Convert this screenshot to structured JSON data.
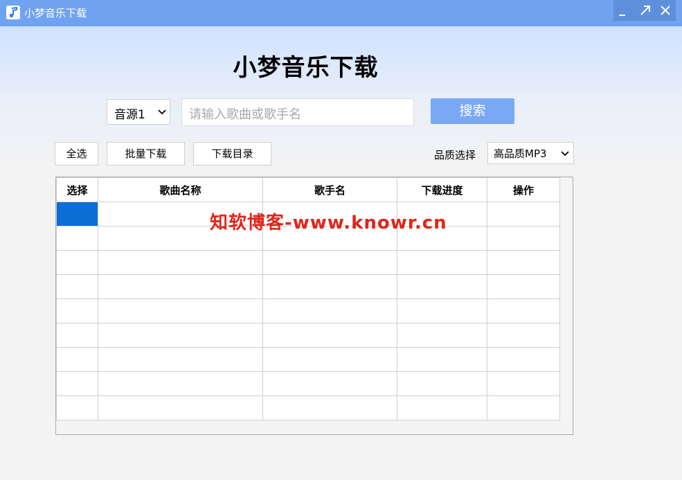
{
  "window": {
    "title": "小梦音乐下载",
    "controls": [
      "minimize",
      "maximize",
      "close"
    ]
  },
  "header": {
    "title": "小梦音乐下载"
  },
  "search": {
    "source_selected": "音源1",
    "placeholder": "请输入歌曲或歌手名",
    "value": "",
    "button_label": "搜索"
  },
  "toolbar": {
    "select_all_label": "全选",
    "batch_download_label": "批量下载",
    "download_dir_label": "下载目录",
    "quality_label": "品质选择",
    "quality_selected": "高品质MP3"
  },
  "table": {
    "columns": [
      "选择",
      "歌曲名称",
      "歌手名",
      "下载进度",
      "操作"
    ],
    "rows": [
      [
        "",
        "",
        "",
        "",
        ""
      ],
      [
        "",
        "",
        "",
        "",
        ""
      ],
      [
        "",
        "",
        "",
        "",
        ""
      ],
      [
        "",
        "",
        "",
        "",
        ""
      ],
      [
        "",
        "",
        "",
        "",
        ""
      ],
      [
        "",
        "",
        "",
        "",
        ""
      ],
      [
        "",
        "",
        "",
        "",
        ""
      ],
      [
        "",
        "",
        "",
        "",
        ""
      ],
      [
        "",
        "",
        "",
        "",
        ""
      ]
    ],
    "selected_row": 0
  },
  "watermark": {
    "text": "知软博客-www.knowr.cn"
  },
  "colors": {
    "titlebar": "#6fa3f1",
    "accent": "#79a9f5",
    "selection": "#0b6fd6",
    "watermark": "#e1251b"
  }
}
